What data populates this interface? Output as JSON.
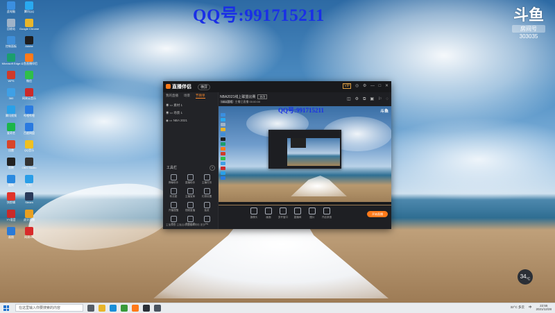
{
  "watermark": {
    "qq_text": "QQ号:991715211"
  },
  "brand": {
    "mark": "斗鱼",
    "tag": "房间号",
    "room_number": "303035"
  },
  "desktop_icons": [
    {
      "label": "此电脑",
      "color": "#3b8fe0"
    },
    {
      "label": "腾讯QQ",
      "color": "#29a9f0"
    },
    {
      "label": "回收站",
      "color": "#9fb3c8"
    },
    {
      "label": "Google Chrome",
      "color": "#e8b52a"
    },
    {
      "label": "控制面板",
      "color": "#3f8ed8"
    },
    {
      "label": "Adobe",
      "color": "#1e1e1e"
    },
    {
      "label": "Microsoft Edge",
      "color": "#1a9e6e"
    },
    {
      "label": "斗鱼直播伴侣",
      "color": "#ff7a1a"
    },
    {
      "label": "WPS",
      "color": "#d03a2a"
    },
    {
      "label": "微信",
      "color": "#2fbf4a"
    },
    {
      "label": "360",
      "color": "#3fa0e6"
    },
    {
      "label": "网易云音乐",
      "color": "#cc2a2a"
    },
    {
      "label": "腾讯视频",
      "color": "#2aa0e8"
    },
    {
      "label": "哔哩哔哩",
      "color": "#2a7be0"
    },
    {
      "label": "爱奇艺",
      "color": "#1ab64a"
    },
    {
      "label": "百度网盘",
      "color": "#2a7ae0"
    },
    {
      "label": "迅雷",
      "color": "#d8452a"
    },
    {
      "label": "QQ音乐",
      "color": "#f0c020"
    },
    {
      "label": "剪映",
      "color": "#222222"
    },
    {
      "label": "OBS Studio",
      "color": "#333333"
    },
    {
      "label": "酷狗",
      "color": "#2a8ae0"
    },
    {
      "label": "钉钉",
      "color": "#2a9ee8"
    },
    {
      "label": "快剪辑",
      "color": "#e0332a"
    },
    {
      "label": "Steam",
      "color": "#2a3a5a"
    },
    {
      "label": "YY语音",
      "color": "#c82a2a"
    },
    {
      "label": "虎牙直播",
      "color": "#e8a020"
    },
    {
      "label": "画图",
      "color": "#2a7ad8"
    },
    {
      "label": "网易UU",
      "color": "#d82a2a"
    }
  ],
  "weather_badge": {
    "value": "34",
    "unit": "°C"
  },
  "app": {
    "title": "直播伴侣",
    "mode": "横屏",
    "window_controls": [
      "VIP",
      "◎",
      "⚙",
      "—",
      "□",
      "✕"
    ],
    "left_tabs": [
      "我的直播",
      "场景",
      "节目单"
    ],
    "scenes": [
      "素材 1",
      "场景 1",
      "NBA 2021"
    ],
    "tools_title": "工具栏",
    "tools": [
      "弹幕助手",
      "直播助手",
      "主播任务",
      "粉丝团",
      "主播宝库",
      "礼物设置",
      "开播提醒",
      "视频直播",
      "抽奖",
      "音乐",
      "语音连麦",
      "PK"
    ],
    "footer": "主播公告  主播活动  直播间帮助  更多",
    "room_title": "NBA2021线上联盟比赛",
    "room_badge": "修改",
    "room_sub_pill": "NBA游戏",
    "room_sub_text": "主播已直播 00:00:00",
    "top_icons": [
      "◫",
      "⚙",
      "⧉",
      "▣",
      "⚐",
      "◌"
    ],
    "preview_qq": "QQ号:991715211",
    "preview_logo": "斗鱼",
    "actions": [
      "摄像头",
      "画面",
      "多开窗口",
      "直播间",
      "图片",
      "开启录音"
    ],
    "live_button": "开始直播"
  },
  "taskbar": {
    "search_placeholder": "在这里输入你要搜索的内容",
    "apps": [
      {
        "name": "task-view",
        "color": "#555d66"
      },
      {
        "name": "file-explorer",
        "color": "#e8b52a"
      },
      {
        "name": "edge",
        "color": "#1a8fd8"
      },
      {
        "name": "chrome",
        "color": "#3a9a3a"
      },
      {
        "name": "douyu",
        "color": "#ff7a1a"
      },
      {
        "name": "app-1",
        "color": "#2a2f36"
      },
      {
        "name": "app-2",
        "color": "#4a5460"
      }
    ],
    "tray_weather": "32°C 多云",
    "tray_lang": "中",
    "tray_time": "22:55",
    "tray_date": "2021/12/28"
  }
}
